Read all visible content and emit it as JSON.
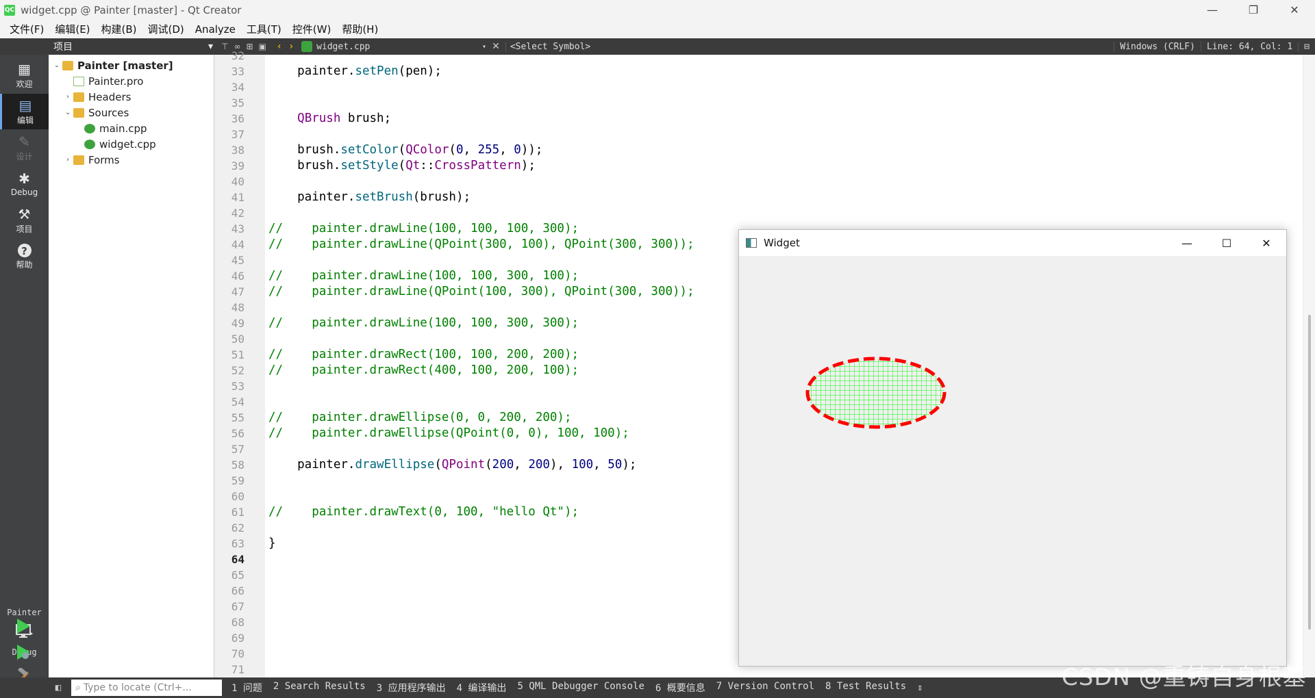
{
  "window": {
    "title": "widget.cpp @ Painter [master] - Qt Creator",
    "logo": "QC",
    "minimize": "—",
    "restore": "❐",
    "close": "✕"
  },
  "menubar": [
    "文件(F)",
    "编辑(E)",
    "构建(B)",
    "调试(D)",
    "Analyze",
    "工具(T)",
    "控件(W)",
    "帮助(H)"
  ],
  "toolbar": {
    "project_selector": "项目",
    "file_name": "widget.cpp",
    "symbol": "<Select Symbol>",
    "line_ending": "Windows (CRLF)",
    "cursor_pos": "Line: 64, Col: 1"
  },
  "modes": [
    {
      "label": "欢迎",
      "icon": "grid-icon",
      "glyph": "▦"
    },
    {
      "label": "编辑",
      "icon": "edit-icon",
      "glyph": "▤"
    },
    {
      "label": "设计",
      "icon": "pencil-icon",
      "glyph": "✎"
    },
    {
      "label": "Debug",
      "icon": "bug-icon",
      "glyph": "✱"
    },
    {
      "label": "项目",
      "icon": "wrench-icon",
      "glyph": "⚒"
    },
    {
      "label": "帮助",
      "icon": "help-icon",
      "glyph": "?"
    }
  ],
  "kit": {
    "project": "Painter",
    "build": "Debug"
  },
  "tree": [
    {
      "label": "Painter [master]",
      "depth": 0,
      "arrow": "v",
      "icon": "project"
    },
    {
      "label": "Painter.pro",
      "depth": 1,
      "arrow": "",
      "icon": "pro"
    },
    {
      "label": "Headers",
      "depth": 1,
      "arrow": ">",
      "icon": "folder"
    },
    {
      "label": "Sources",
      "depth": 1,
      "arrow": "v",
      "icon": "folder"
    },
    {
      "label": "main.cpp",
      "depth": 2,
      "arrow": "",
      "icon": "cpp"
    },
    {
      "label": "widget.cpp",
      "depth": 2,
      "arrow": "",
      "icon": "cpp"
    },
    {
      "label": "Forms",
      "depth": 1,
      "arrow": ">",
      "icon": "folder"
    }
  ],
  "editor": {
    "current_line": 64,
    "lines": [
      {
        "n": 32,
        "segs": []
      },
      {
        "n": 33,
        "segs": [
          [
            "",
            "    painter."
          ],
          [
            "fn",
            "setPen"
          ],
          [
            "",
            "(pen);"
          ]
        ]
      },
      {
        "n": 34,
        "segs": []
      },
      {
        "n": 35,
        "segs": []
      },
      {
        "n": 36,
        "segs": [
          [
            "",
            "    "
          ],
          [
            "ty",
            "QBrush"
          ],
          [
            "",
            " brush;"
          ]
        ]
      },
      {
        "n": 37,
        "segs": []
      },
      {
        "n": 38,
        "segs": [
          [
            "",
            "    brush."
          ],
          [
            "fn",
            "setColor"
          ],
          [
            "",
            "("
          ],
          [
            "ty",
            "QColor"
          ],
          [
            "",
            "("
          ],
          [
            "num",
            "0"
          ],
          [
            "",
            ", "
          ],
          [
            "num",
            "255"
          ],
          [
            "",
            ", "
          ],
          [
            "num",
            "0"
          ],
          [
            "",
            "));"
          ]
        ]
      },
      {
        "n": 39,
        "segs": [
          [
            "",
            "    brush."
          ],
          [
            "fn",
            "setStyle"
          ],
          [
            "",
            "("
          ],
          [
            "ty",
            "Qt"
          ],
          [
            "",
            "::"
          ],
          [
            "ty",
            "CrossPattern"
          ],
          [
            "",
            ");"
          ]
        ]
      },
      {
        "n": 40,
        "segs": []
      },
      {
        "n": 41,
        "segs": [
          [
            "",
            "    painter."
          ],
          [
            "fn",
            "setBrush"
          ],
          [
            "",
            "(brush);"
          ]
        ]
      },
      {
        "n": 42,
        "segs": []
      },
      {
        "n": 43,
        "segs": [
          [
            "cm",
            "//    painter.drawLine(100, 100, 100, 300);"
          ]
        ]
      },
      {
        "n": 44,
        "segs": [
          [
            "cm",
            "//    painter.drawLine(QPoint(300, 100), QPoint(300, 300));"
          ]
        ]
      },
      {
        "n": 45,
        "segs": []
      },
      {
        "n": 46,
        "segs": [
          [
            "cm",
            "//    painter.drawLine(100, 100, 300, 100);"
          ]
        ]
      },
      {
        "n": 47,
        "segs": [
          [
            "cm",
            "//    painter.drawLine(QPoint(100, 300), QPoint(300, 300));"
          ]
        ]
      },
      {
        "n": 48,
        "segs": []
      },
      {
        "n": 49,
        "segs": [
          [
            "cm",
            "//    painter.drawLine(100, 100, 300, 300);"
          ]
        ]
      },
      {
        "n": 50,
        "segs": []
      },
      {
        "n": 51,
        "segs": [
          [
            "cm",
            "//    painter.drawRect(100, 100, 200, 200);"
          ]
        ]
      },
      {
        "n": 52,
        "segs": [
          [
            "cm",
            "//    painter.drawRect(400, 100, 200, 100);"
          ]
        ]
      },
      {
        "n": 53,
        "segs": []
      },
      {
        "n": 54,
        "segs": []
      },
      {
        "n": 55,
        "segs": [
          [
            "cm",
            "//    painter.drawEllipse(0, 0, 200, 200);"
          ]
        ]
      },
      {
        "n": 56,
        "segs": [
          [
            "cm",
            "//    painter.drawEllipse(QPoint(0, 0), 100, 100);"
          ]
        ]
      },
      {
        "n": 57,
        "segs": []
      },
      {
        "n": 58,
        "segs": [
          [
            "",
            "    painter."
          ],
          [
            "fn",
            "drawEllipse"
          ],
          [
            "",
            "("
          ],
          [
            "ty",
            "QPoint"
          ],
          [
            "",
            "("
          ],
          [
            "num",
            "200"
          ],
          [
            "",
            ", "
          ],
          [
            "num",
            "200"
          ],
          [
            "",
            "), "
          ],
          [
            "num",
            "100"
          ],
          [
            "",
            ", "
          ],
          [
            "num",
            "50"
          ],
          [
            "",
            ");"
          ]
        ]
      },
      {
        "n": 59,
        "segs": []
      },
      {
        "n": 60,
        "segs": []
      },
      {
        "n": 61,
        "segs": [
          [
            "cm",
            "//    painter.drawText(0, 100, \"hello Qt\");"
          ]
        ]
      },
      {
        "n": 62,
        "segs": []
      },
      {
        "n": 63,
        "segs": [
          [
            "",
            "}"
          ]
        ]
      },
      {
        "n": 64,
        "segs": []
      },
      {
        "n": 65,
        "segs": []
      },
      {
        "n": 66,
        "segs": []
      },
      {
        "n": 67,
        "segs": []
      },
      {
        "n": 68,
        "segs": []
      },
      {
        "n": 69,
        "segs": []
      },
      {
        "n": 70,
        "segs": []
      },
      {
        "n": 71,
        "segs": []
      }
    ],
    "modified_lines": [
      33,
      36,
      37,
      38,
      39,
      40,
      41,
      58,
      59,
      60,
      61,
      62
    ]
  },
  "statusbar": {
    "locator_placeholder": "Type to locate (Ctrl+...",
    "panes": [
      "1 问题",
      "2 Search Results",
      "3 应用程序输出",
      "4 编译输出",
      "5 QML Debugger Console",
      "6 概要信息",
      "7 Version Control",
      "8 Test Results"
    ],
    "more": "⇕"
  },
  "widget_window": {
    "title": "Widget",
    "minimize": "—",
    "maximize": "☐",
    "close": "✕",
    "ellipse": {
      "center": [
        200,
        200
      ],
      "rx": 100,
      "ry": 50,
      "fill_color": "#00ff00",
      "fill_pattern": "CrossPattern",
      "pen_color": "#ff0000",
      "pen_style": "dash"
    }
  },
  "watermark": "CSDN @重铸自身根基"
}
